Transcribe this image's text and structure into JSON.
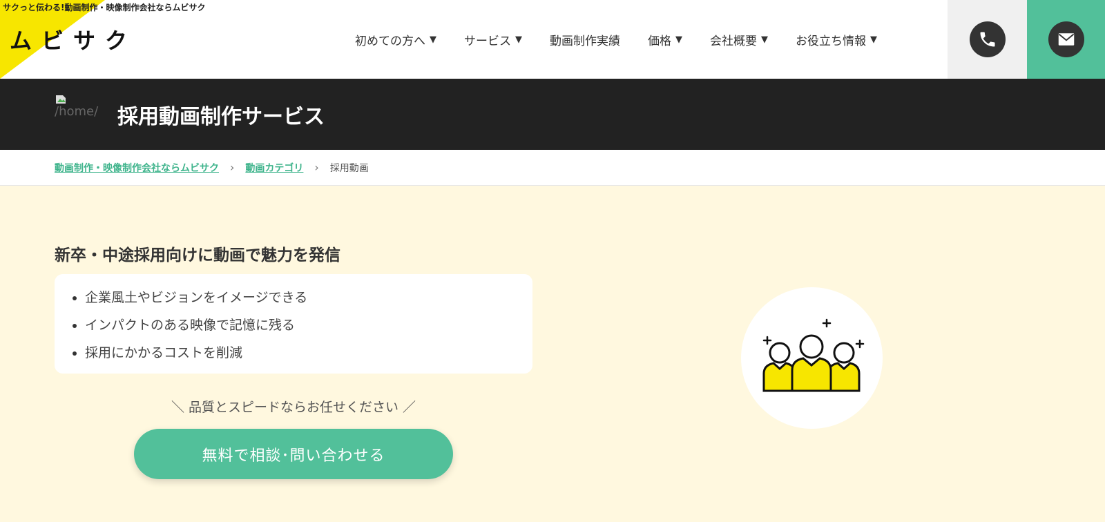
{
  "header": {
    "tagline": "サクっと伝わる!動画制作・映像制作会社ならムビサク",
    "logo": "ムビサク",
    "nav": [
      {
        "label": "初めての方へ",
        "caret": "▼"
      },
      {
        "label": "サービス",
        "caret": "▼"
      },
      {
        "label": "動画制作実績",
        "caret": ""
      },
      {
        "label": "価格",
        "caret": "▼"
      },
      {
        "label": "会社概要",
        "caret": "▼"
      },
      {
        "label": "お役立ち情報",
        "caret": "▼"
      }
    ],
    "phone_icon": "phone-icon",
    "mail_icon": "mail-icon"
  },
  "titlebar": {
    "broken_image_alt": "/home/conter",
    "title": "採用動画制作サービス"
  },
  "breadcrumb": {
    "items": [
      {
        "label": "動画制作・映像制作会社ならムビサク"
      },
      {
        "label": "動画カテゴリ"
      }
    ],
    "separator": "›",
    "current": "採用動画"
  },
  "main": {
    "heading": "新卒・中途採用向けに動画で魅力を発信",
    "points": [
      "企業風土やビジョンをイメージできる",
      "インパクトのある映像で記憶に残る",
      "採用にかかるコストを削減"
    ],
    "catch": "＼ 品質とスピードならお任せください ／",
    "cta": "無料で相談･問い合わせる",
    "illustration_icon": "team-people-icon"
  },
  "colors": {
    "accent": "#52c09a",
    "brand_yellow": "#f7e600",
    "dark": "#222222",
    "background": "#fff8df"
  }
}
